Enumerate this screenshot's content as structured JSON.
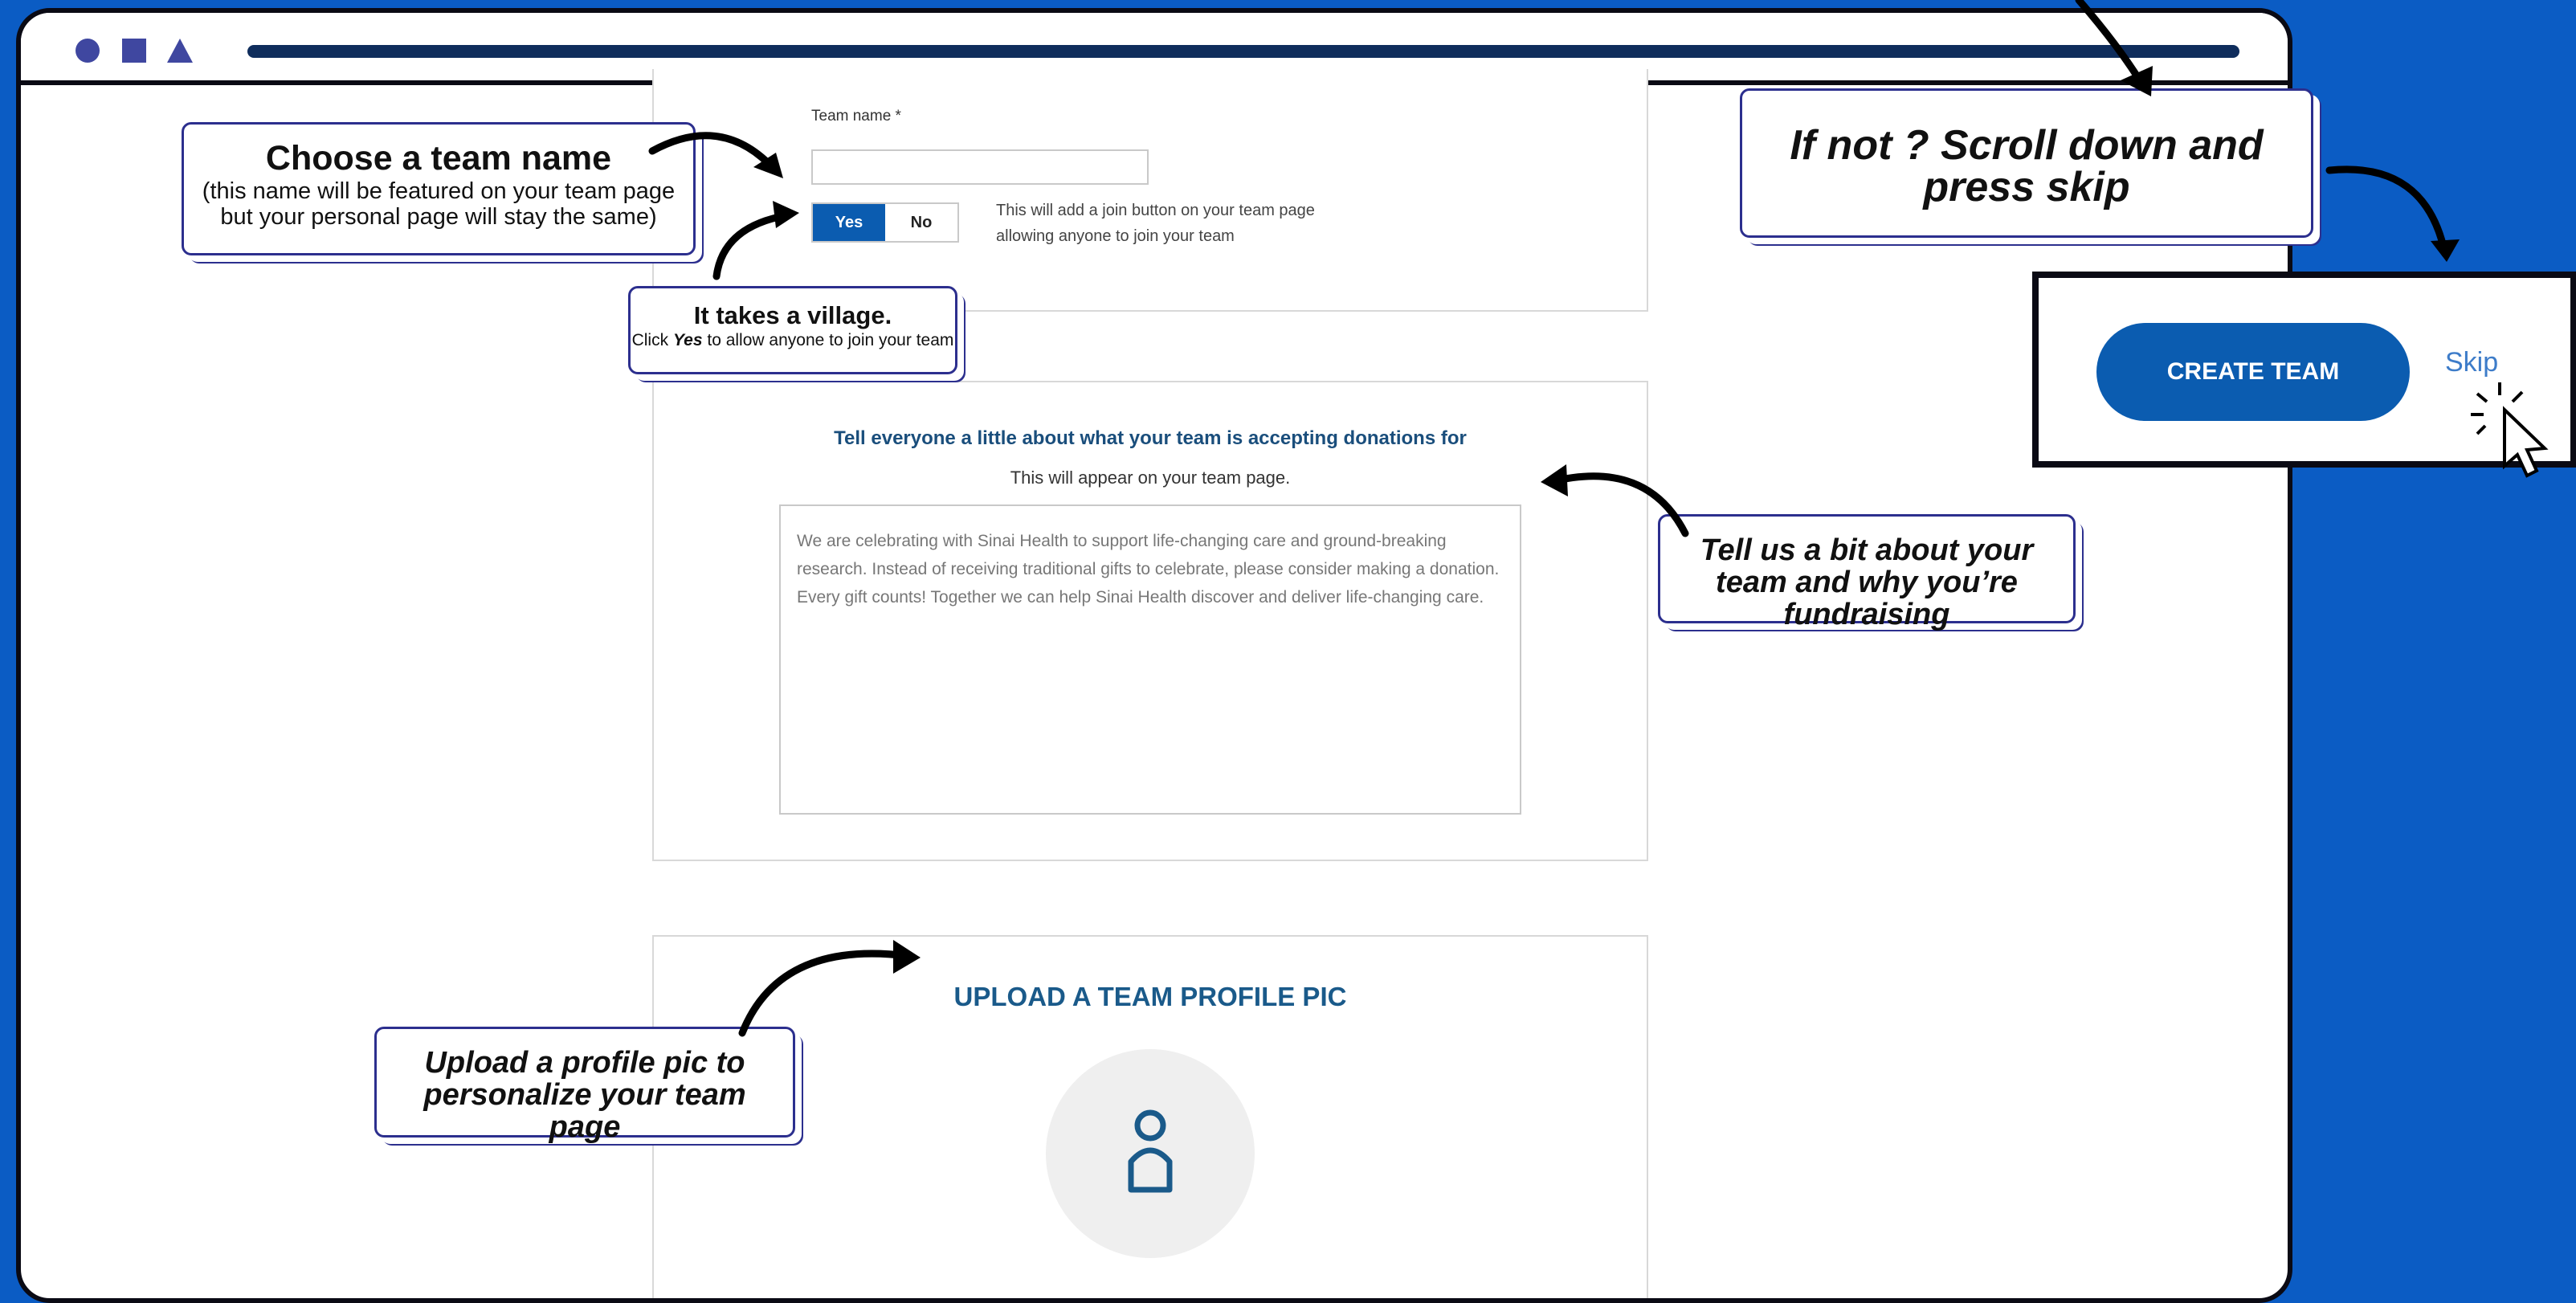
{
  "form": {
    "team_name_label": "Team name *",
    "team_name_value": "",
    "join_toggle": {
      "yes_label": "Yes",
      "no_label": "No",
      "selected": "Yes"
    },
    "join_hint": "This will add a join button on your team page allowing anyone to join your team"
  },
  "donations_section": {
    "heading": "Tell everyone a little about what your team is accepting donations for",
    "subheading": "This will appear on your team page.",
    "placeholder": "We are celebrating with Sinai Health to support life-changing care and ground-breaking research. Instead of receiving traditional gifts to celebrate, please consider making a donation. Every gift counts! Together we can help Sinai Health discover and deliver life-changing care."
  },
  "upload_section": {
    "heading": "UPLOAD A TEAM PROFILE PIC"
  },
  "callouts": {
    "team_name_title": "Choose a team name",
    "team_name_body": "(this name will be featured on your team page but your personal page will stay the same)",
    "village_title": "It takes a village.",
    "village_body_pre": "Click ",
    "village_body_em": "Yes",
    "village_body_post": " to allow anyone to join your team",
    "about_team": "Tell us a bit about your team and why you’re fundraising",
    "upload_pic": "Upload a profile pic to personalize your team page",
    "scroll_skip": "If not ? Scroll down and press skip"
  },
  "actions": {
    "create_team": "CREATE TEAM",
    "skip": "Skip"
  },
  "colors": {
    "background": "#0b5cc4",
    "primary_button": "#0b5cb0",
    "callout_border": "#2c2f8e",
    "window_dots": "#3f47a0"
  },
  "icons": [
    "window-circle-icon",
    "window-square-icon",
    "window-triangle-icon",
    "user-icon",
    "cursor-icon",
    "arrow-icon"
  ]
}
